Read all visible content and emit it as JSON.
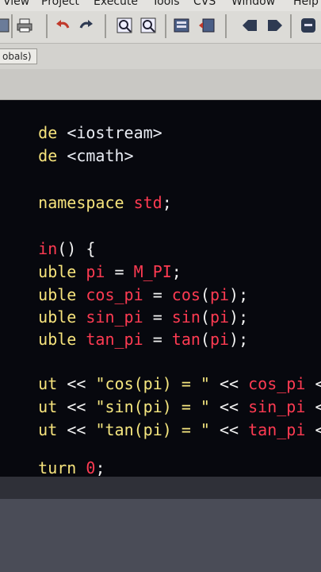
{
  "menu": [
    "View",
    "Project",
    "Execute",
    "Tools",
    "CVS",
    "Window",
    "Help"
  ],
  "toolbar_icons": [
    "grid-icon",
    "print-icon",
    "undo-icon",
    "redo-icon",
    "find-icon",
    "replace-icon",
    "layout-icon",
    "goto-icon",
    "window-prev-icon",
    "window-next-icon",
    "close-icon"
  ],
  "scope_label": "obals)",
  "code": {
    "l1": {
      "a": "de",
      "b": "<iostream>"
    },
    "l2": {
      "a": "de",
      "b": "<cmath>"
    },
    "l3": {
      "a": "namespace",
      "b": "std",
      "c": ";"
    },
    "l4": {
      "a": "in",
      "b": "() {"
    },
    "l5": {
      "a": "uble",
      "b": "pi",
      "c": "=",
      "d": "M_PI",
      "e": ";"
    },
    "l6": {
      "a": "uble",
      "b": "cos_pi",
      "c": "=",
      "d": "cos",
      "e": "(",
      "f": "pi",
      "g": ");"
    },
    "l7": {
      "a": "uble",
      "b": "sin_pi",
      "c": "=",
      "d": "sin",
      "e": "(",
      "f": "pi",
      "g": ");"
    },
    "l8": {
      "a": "uble",
      "b": "tan_pi",
      "c": "=",
      "d": "tan",
      "e": "(",
      "f": "pi",
      "g": ");"
    },
    "l9": {
      "a": "ut",
      "b": "<<",
      "c": "\"cos(pi) = \"",
      "d": "<<",
      "e": "cos_pi",
      "f": "<<"
    },
    "l10": {
      "a": "ut",
      "b": "<<",
      "c": "\"sin(pi) = \"",
      "d": "<<",
      "e": "sin_pi",
      "f": "<<"
    },
    "l11": {
      "a": "ut",
      "b": "<<",
      "c": "\"tan(pi) = \"",
      "d": "<<",
      "e": "tan_pi",
      "f": "<<"
    },
    "l12": {
      "a": "turn",
      "b": "0",
      "c": ";"
    }
  },
  "colors": {
    "keyword": "#f6e37c",
    "identifier": "#ff3b52",
    "editor_bg": "#07080e"
  }
}
